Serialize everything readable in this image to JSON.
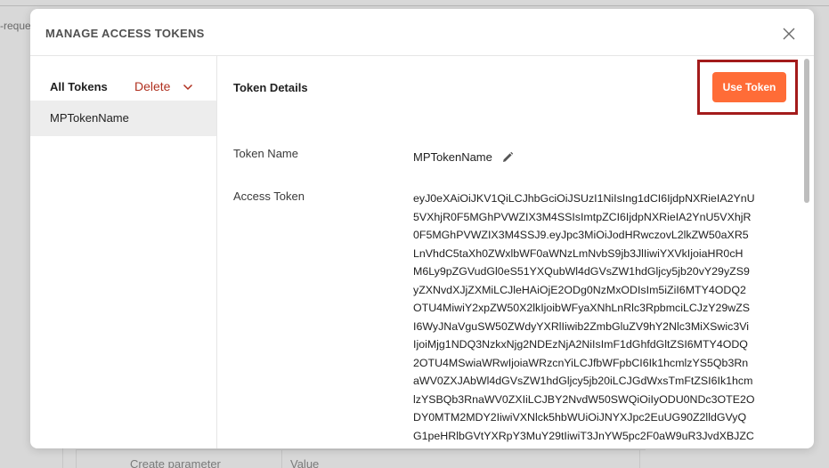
{
  "background": {
    "tab_fragment": "-reque",
    "table_cells": [
      "Create parameter",
      "Value"
    ]
  },
  "modal": {
    "title": "MANAGE ACCESS TOKENS",
    "close_icon": "close-icon"
  },
  "sidebar": {
    "all_tokens_label": "All Tokens",
    "delete_label": "Delete",
    "tokens": [
      {
        "label": "MPTokenName"
      }
    ]
  },
  "details": {
    "title": "Token Details",
    "use_token_label": "Use Token",
    "token_name_label": "Token Name",
    "token_name_value": "MPTokenName",
    "access_token_label": "Access Token",
    "access_token_lines": [
      "eyJ0eXAiOiJKV1QiLCJhbGciOiJSUzI1NiIsIng1dCI6IjdpNXRieIA2YnU",
      "5VXhjR0F5MGhPVWZIX3M4SSIsImtpZCI6IjdpNXRieIA2YnU5VXhjR",
      "0F5MGhPVWZIX3M4SSJ9.eyJpc3MiOiJodHRwczovL2lkZW50aXR5",
      "LnVhdC5taXh0ZWxlbWF0aWNzLmNvbS9jb3JlIiwiYXVkIjoiaHR0cH",
      "M6Ly9pZGVudGl0eS51YXQubWl4dGVsZW1hdGljcy5jb20vY29yZS9",
      "yZXNvdXJjZXMiLCJleHAiOjE2ODg0NzMxODIsIm5iZiI6MTY4ODQ2",
      "OTU4MiwiY2xpZW50X2lkIjoibWFyaXNhLnRlc3RpbmciLCJzY29wZS",
      "I6WyJNaVguSW50ZWdyYXRlIiwib2ZmbGluZV9hY2Nlc3MiXSwic3Vi",
      "IjoiMjg1NDQ3NzkxNjg2NDEzNjA2NiIsImF1dGhfdGltZSI6MTY4ODQ",
      "2OTU4MSwiaWRwIjoiaWRzcnYiLCJfbWFpbCI6Ik1hcmlzYS5Qb3Rn",
      "aWV0ZXJAbWl4dGVsZW1hdGljcy5jb20iLCJGdWxsTmFtZSI6Ik1hcm",
      "lzYSBQb3RnaWV0ZXIiLCJBY2NvdW50SWQiOiIyODU0NDc3OTE2O",
      "DY0MTM2MDY2IiwiVXNlck5hbWUiOiJNYXJpc2EuUG90Z2lldGVyQ",
      "G1peHRlbGVtYXRpY3MuY29tIiwiT3JnYW5pc2F0aW9uR3JvdXBJZC"
    ]
  },
  "icons": {
    "delete_chevron": "chevron-down-icon",
    "edit": "pencil-icon"
  },
  "colors": {
    "accent": "#ff6c37",
    "delete": "#b0301f",
    "highlight_box": "#a31b1b"
  }
}
